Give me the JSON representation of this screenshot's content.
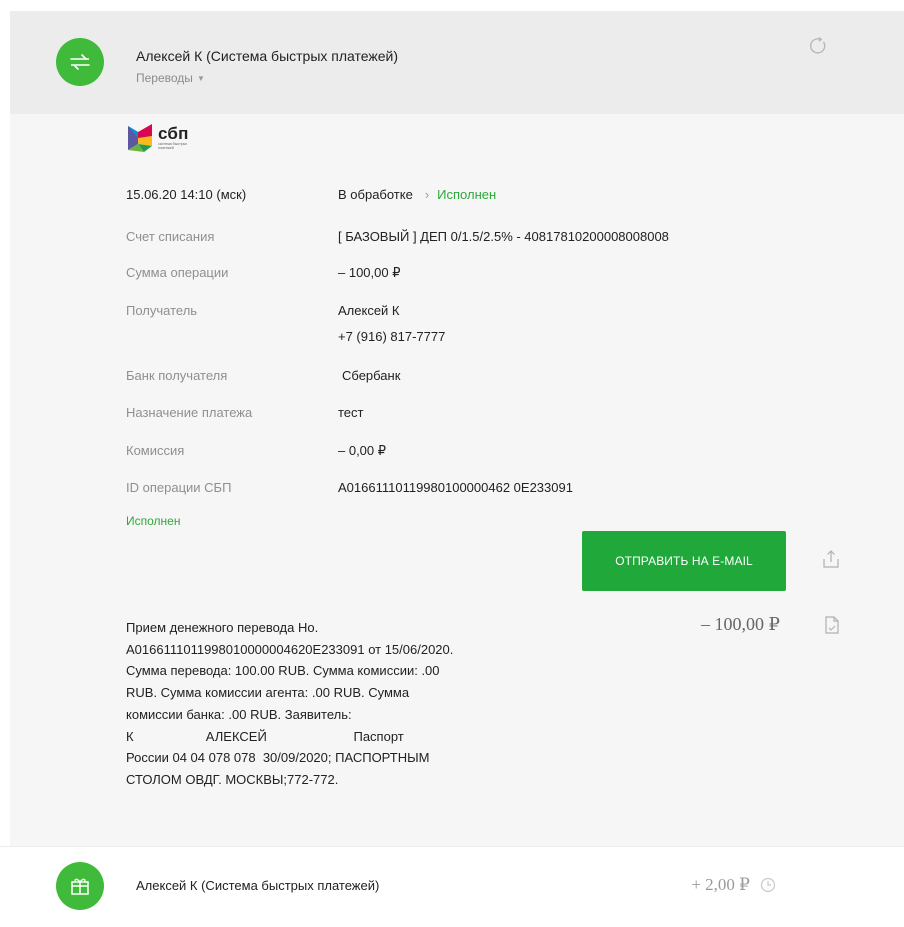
{
  "operation": {
    "title": "Алексей К (Система быстрых платежей)",
    "category": "Переводы",
    "logo_text": "сбп",
    "logo_subtext": "система быстрых платежей"
  },
  "details": {
    "datetime": "15.06.20 14:10 (мск)",
    "status_from": "В обработке",
    "status_separator": "›",
    "status_to": "Исполнен",
    "rows": [
      {
        "label": "Счет списания",
        "value": "[ БАЗОВЫЙ ] ДЕП 0/1.5/2.5% - 40817810200008008008"
      },
      {
        "label": "Сумма операции",
        "value": "– 100,00 ₽"
      },
      {
        "label": "Получатель",
        "value": "Алексей К",
        "value2": "+7 (916) 817-7777"
      },
      {
        "label": "Банк получателя",
        "value": "Сбербанк"
      },
      {
        "label": "Назначение платежа",
        "value": "тест"
      },
      {
        "label": "Комиссия",
        "value": "– 0,00 ₽"
      },
      {
        "label": "ID операции СБП",
        "value": "A01661110119980100000462 0E233091"
      }
    ],
    "status_label": "Исполнен"
  },
  "actions": {
    "email_label": "ОТПРАВИТЬ НА E-MAIL"
  },
  "description": {
    "text": "Прием денежного перевода Но.\nA0166111011998010000004620E233091 от 15/06/2020.\nСумма перевода: 100.00 RUB. Сумма комиссии: .00\nRUB. Сумма комиссии агента: .00 RUB. Сумма\nкомиссии банка: .00 RUB. Заявитель:\nК                    АЛЕКСЕЙ                        Паспорт\nРоссии 04 04 078 078  30/09/2020; ПАСПОРТНЫМ\nСТОЛОМ ОВДГ. МОСКВЫ;772-772.",
    "amount": "– 100,00 ₽"
  },
  "next_operation": {
    "title": "Алексей  К (Система быстрых платежей)",
    "amount": "+ 2,00 ₽"
  },
  "colors": {
    "accent_green": "#3fba3a",
    "button_green": "#20a83b",
    "status_green": "#2ea83a"
  }
}
